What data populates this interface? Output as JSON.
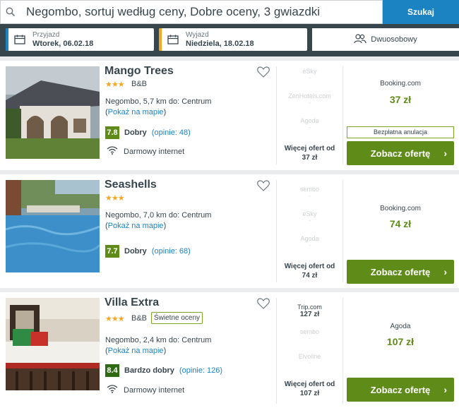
{
  "search": {
    "query": "Negombo, sortuj według ceny, Dobre oceny, 3 gwiazdki",
    "button_label": "Szukaj"
  },
  "dates": {
    "checkin_label": "Przyjazd",
    "checkin_value": "Wtorek, 06.02.18",
    "checkout_label": "Wyjazd",
    "checkout_value": "Niedziela, 18.02.18"
  },
  "room": {
    "label": "Dwuosobowy"
  },
  "colors": {
    "header": "#37454d",
    "accent": "#1b83c2",
    "green": "#5f8b19",
    "star": "#f5a623",
    "checkin_strip": "#1b83c2",
    "checkout_strip": "#f5a623"
  },
  "hotels": [
    {
      "name": "Mango Trees",
      "stars": "★★★",
      "type": "B&B",
      "location": "Negombo, 5,7 km do: Centrum",
      "map_link": "Pokaż na mapie",
      "score": "7.8",
      "score_label": "Dobry",
      "reviews": "opinie: 48",
      "amenity": "Darmowy internet",
      "providers": [
        "eSky",
        "ZenHotels.com",
        "Agoda"
      ],
      "more_offers": "Więcej ofert od",
      "more_price": "37 zł",
      "best_site": "Booking.com",
      "best_price": "37 zł",
      "free_cancel": "Bezpłatna anulacja",
      "deal_label": "Zobacz ofertę"
    },
    {
      "name": "Seashells",
      "stars": "★★★",
      "location": "Negombo, 7,0 km do: Centrum",
      "map_link": "Pokaż na mapie",
      "score": "7.7",
      "score_label": "Dobry",
      "reviews": "opinie: 68",
      "providers": [
        "sembo",
        "eSky",
        "Agoda"
      ],
      "more_offers": "Więcej ofert od",
      "more_price": "74 zł",
      "best_site": "Booking.com",
      "best_price": "74 zł",
      "deal_label": "Zobacz ofertę"
    },
    {
      "name": "Villa Extra",
      "stars": "★★★",
      "type": "B&B",
      "badge": "Świetne oceny",
      "location": "Negombo, 2,4 km do: Centrum",
      "map_link": "Pokaż na mapie",
      "score": "8.4",
      "score_label": "Bardzo dobry",
      "reviews": "opinie: 126",
      "amenity": "Darmowy internet",
      "top_provider": "Trip.com",
      "top_provider_price": "127 zł",
      "providers": [
        "sembo",
        "Elvoline"
      ],
      "more_offers": "Więcej ofert od",
      "more_price": "107 zł",
      "best_site": "Agoda",
      "best_price": "107 zł",
      "deal_label": "Zobacz ofertę"
    }
  ]
}
